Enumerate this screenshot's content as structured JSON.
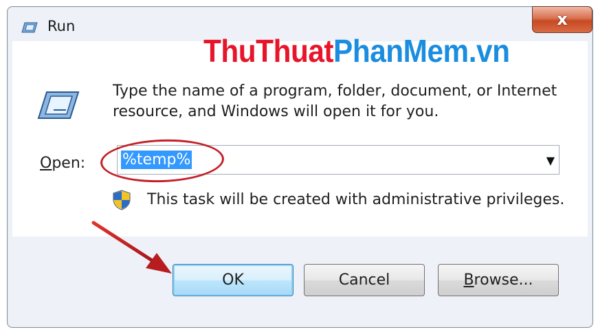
{
  "window": {
    "title": "Run",
    "close_label": "x"
  },
  "watermark": {
    "part1": "ThuThuat",
    "part2": "PhanMem.vn"
  },
  "description": "Type the name of a program, folder, document, or Internet resource, and Windows will open it for you.",
  "open": {
    "label_mnemonic": "O",
    "label_rest": "pen:",
    "value": "%temp%"
  },
  "admin_note": "This task will be created with administrative privileges.",
  "buttons": {
    "ok": "OK",
    "cancel": "Cancel",
    "browse_mnemonic": "B",
    "browse_rest": "rowse..."
  },
  "icons": {
    "title": "run-icon",
    "main": "run-icon",
    "shield": "uac-shield-icon",
    "dropdown": "chevron-down-icon"
  },
  "colors": {
    "highlight": "#3399ff",
    "annotation": "#c4202a",
    "watermark_red": "#e8152a",
    "watermark_blue": "#1a8de0"
  }
}
